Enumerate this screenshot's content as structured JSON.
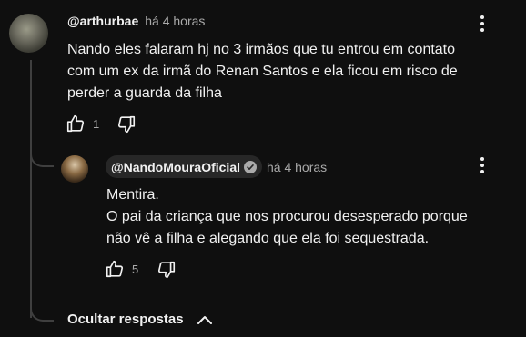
{
  "comment": {
    "author": "@arthurbae",
    "time": "há 4 horas",
    "text_lines": [
      "Nando eles falaram hj no 3 irmãos que tu entrou em contato",
      "com um ex da irmã do Renan Santos e ela ficou em risco de",
      "perder a guarda da filha"
    ],
    "like_count": "1",
    "icons": [
      "like-icon",
      "dislike-icon",
      "more-vert-icon"
    ]
  },
  "reply": {
    "author": "@NandoMouraOficial",
    "verified": true,
    "time": "há 4 horas",
    "text_lines": [
      "Mentira.",
      "O pai da criança que nos procurou desesperado porque",
      "não vê a filha e alegando que ela foi sequestrada."
    ],
    "like_count": "5",
    "icons": [
      "like-icon",
      "dislike-icon",
      "more-vert-icon",
      "verified-check-icon"
    ]
  },
  "hide_replies": {
    "label": "Ocultar respostas",
    "icon": "chevron-up-icon"
  },
  "colors": {
    "background": "#0f0f0f",
    "text": "#f1f1f1",
    "secondary_text": "#aaaaaa",
    "owner_chip": "#272727"
  }
}
